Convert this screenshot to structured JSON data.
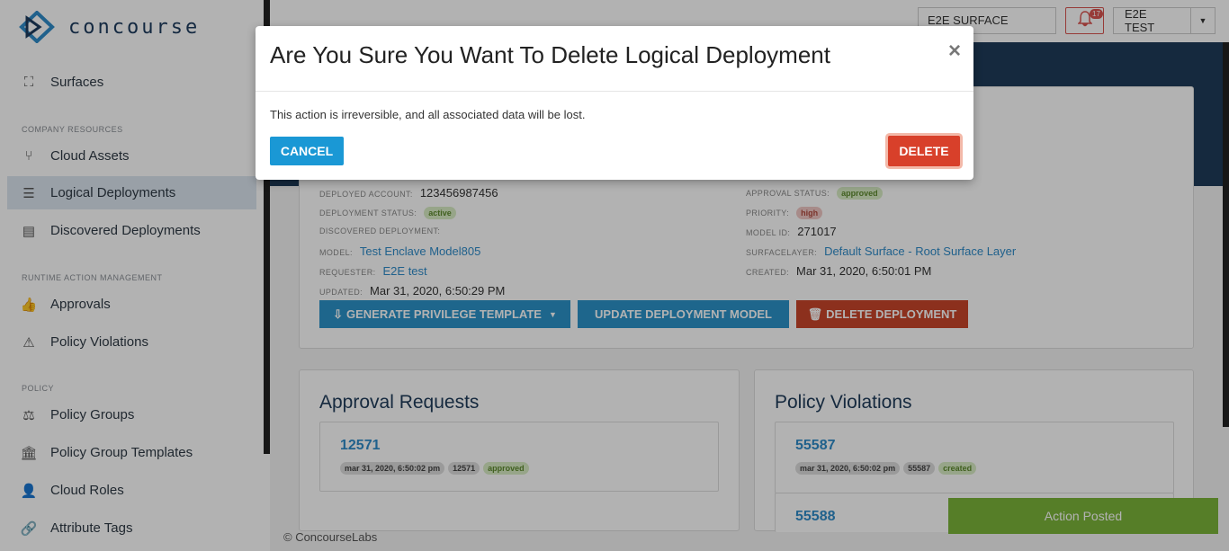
{
  "app": {
    "logo_text": "concourse"
  },
  "topbar": {
    "surface": "E2E SURFACE",
    "notifications_count": "17",
    "user": "E2E TEST"
  },
  "sidebar": {
    "surfaces": "Surfaces",
    "section_company": "COMPANY RESOURCES",
    "cloud_assets": "Cloud Assets",
    "logical_deployments": "Logical Deployments",
    "discovered_deployments": "Discovered Deployments",
    "section_runtime": "RUNTIME ACTION MANAGEMENT",
    "approvals": "Approvals",
    "policy_violations": "Policy Violations",
    "section_policy": "POLICY",
    "policy_groups": "Policy Groups",
    "policy_group_templates": "Policy Group Templates",
    "cloud_roles": "Cloud Roles",
    "attribute_tags": "Attribute Tags"
  },
  "details": {
    "deployed_account_label": "DEPLOYED ACCOUNT:",
    "deployed_account": "123456987456",
    "deployment_status_label": "DEPLOYMENT STATUS:",
    "deployment_status": "active",
    "discovered_deployment_label": "DISCOVERED DEPLOYMENT:",
    "model_label": "MODEL:",
    "model": "Test Enclave Model805",
    "requester_label": "REQUESTER:",
    "requester": "E2E test",
    "updated_label": "UPDATED:",
    "updated": "Mar 31, 2020, 6:50:29 PM",
    "approval_status_label": "APPROVAL STATUS:",
    "approval_status": "approved",
    "priority_label": "PRIORITY:",
    "priority": "high",
    "model_id_label": "MODEL ID:",
    "model_id": "271017",
    "surfacelayer_label": "SURFACELAYER:",
    "surfacelayer": "Default Surface - Root Surface Layer",
    "created_label": "CREATED:",
    "created": "Mar 31, 2020, 6:50:01 PM",
    "btn_generate": "GENERATE PRIVILEGE TEMPLATE",
    "btn_update": "UPDATE DEPLOYMENT MODEL",
    "btn_delete": "DELETE DEPLOYMENT"
  },
  "approval_requests": {
    "title": "Approval Requests",
    "items": [
      {
        "id": "12571",
        "date": "mar 31, 2020, 6:50:02 pm",
        "tag": "12571",
        "status": "approved"
      }
    ]
  },
  "policy_violations": {
    "title": "Policy Violations",
    "items": [
      {
        "id": "55587",
        "date": "mar 31, 2020, 6:50:02 pm",
        "tag": "55587",
        "status": "created"
      },
      {
        "id": "55588"
      }
    ]
  },
  "footer": "© ConcourseLabs",
  "toast": "Action Posted",
  "modal": {
    "title": "Are You Sure You Want To Delete Logical Deployment",
    "body": "This action is irreversible, and all associated data will be lost.",
    "cancel": "CANCEL",
    "delete": "DELETE",
    "close": "×"
  }
}
